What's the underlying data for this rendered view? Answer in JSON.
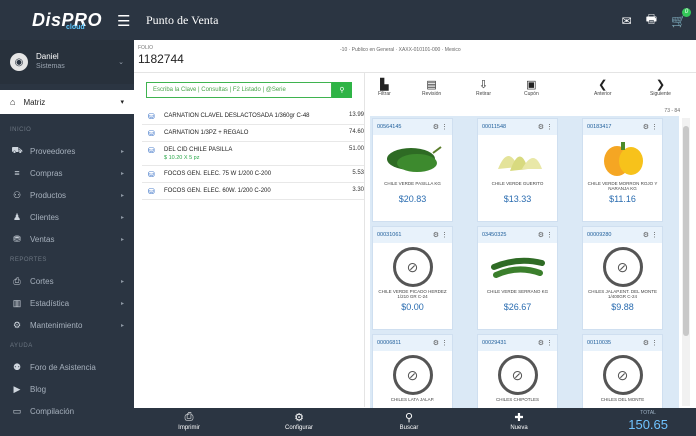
{
  "brand": {
    "logo": "DisPRO",
    "sub": "cloud"
  },
  "header": {
    "title": "Punto de Venta",
    "cart_badge": "0"
  },
  "user": {
    "name": "Daniel",
    "role": "Sistemas"
  },
  "branch": "Matriz",
  "sidebar": {
    "inicio_label": "INICIO",
    "inicio_items": [
      {
        "label": "Proveedores",
        "icon": "truck-icon"
      },
      {
        "label": "Compras",
        "icon": "list-icon"
      },
      {
        "label": "Productos",
        "icon": "products-icon"
      },
      {
        "label": "Clientes",
        "icon": "user-icon"
      },
      {
        "label": "Ventas",
        "icon": "coins-icon"
      }
    ],
    "reportes_label": "REPORTES",
    "reportes_items": [
      {
        "label": "Cortes",
        "icon": "printer-icon"
      },
      {
        "label": "Estadística",
        "icon": "chart-icon"
      },
      {
        "label": "Mantenimiento",
        "icon": "gears-icon"
      }
    ],
    "ayuda_label": "AYUDA",
    "ayuda_items": [
      {
        "label": "Foro de Asistencia",
        "icon": "users-icon"
      },
      {
        "label": "Blog",
        "icon": "video-icon"
      },
      {
        "label": "Compilación",
        "icon": "window-icon"
      }
    ]
  },
  "sale": {
    "folio_label": "FOLIO",
    "folio": "1182744",
    "cliente": "-10 · Publico en General · XAXX-010101-000 · Mexico",
    "search_placeholder": "Escriba la Clave | Consultas | F2 Listado | @Serie"
  },
  "items": [
    {
      "name": "CARNATION CLAVEL DESLACTOSADA 1/360gr C-48",
      "detail": "",
      "price": "13.99"
    },
    {
      "name": "CARNATION 1/3PZ + REGALO",
      "detail": "",
      "price": "74.60"
    },
    {
      "name": "DEL CID CHILE PASILLA",
      "detail": "$ 10.20 X 5 pz",
      "price": "51.00"
    },
    {
      "name": "FOCOS GEN. ELEC. 75 W 1/200 C-200",
      "detail": "",
      "price": "5.53"
    },
    {
      "name": "FOCOS GEN. ELEC. 60W. 1/200 C-200",
      "detail": "",
      "price": "3.30"
    }
  ],
  "toolbar": {
    "filtrar": "Filtrar",
    "revision": "Revisión",
    "retirar": "Retirar",
    "cupon": "Cupón",
    "anterior": "Anterior",
    "siguiente": "Siguiente",
    "range": "73 - 84"
  },
  "products": [
    {
      "code": "00564145",
      "name": "CHILE VERDE PASILLA Kg",
      "price": "$20.83",
      "img": "pepper-icon"
    },
    {
      "code": "00011548",
      "name": "CHILE VERDE GUERITO",
      "price": "$13.33",
      "img": "pepper-icon"
    },
    {
      "code": "00183417",
      "name": "CHILE VERDE MORRON ROJO Y NARANJA kg",
      "price": "$11.16",
      "img": "pepper-icon"
    },
    {
      "code": "00031061",
      "name": "CHILE VERDE PICADO HERDEZ 1/210 GR C-24",
      "price": "$0.00",
      "img": "no-image-icon"
    },
    {
      "code": "03450325",
      "name": "CHILE VERDE SERRANO Kg",
      "price": "$26.67",
      "img": "pepper-icon"
    },
    {
      "code": "00009280",
      "name": "CHILES JALAP.ENT. DEL MONTE 1/400gr C-24",
      "price": "$9.88",
      "img": "no-image-icon"
    },
    {
      "code": "00006811",
      "name": "CHILES LATA JALAP.",
      "price": "",
      "img": "no-image-icon"
    },
    {
      "code": "00029431",
      "name": "CHILES CHIPOTLES",
      "price": "",
      "img": "no-image-icon"
    },
    {
      "code": "00110035",
      "name": "CHILES DEL MONTE",
      "price": "",
      "img": "no-image-icon"
    }
  ],
  "footer": {
    "imprimir": "Imprimir",
    "configurar": "Configurar",
    "buscar": "Buscar",
    "nueva": "Nueva",
    "total_label": "TOTAL",
    "total": "150.65"
  }
}
